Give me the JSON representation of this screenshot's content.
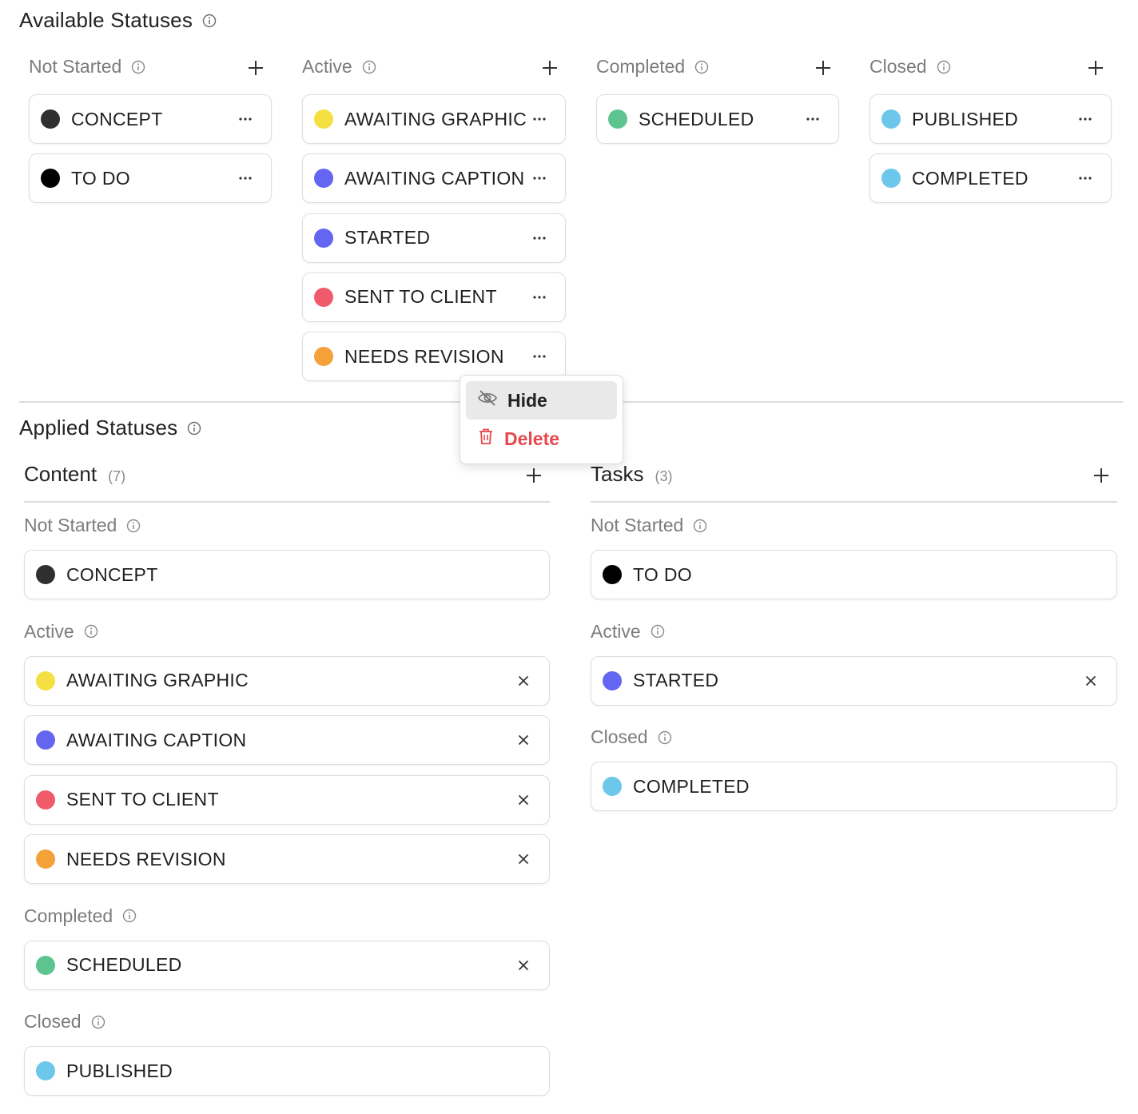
{
  "available": {
    "title": "Available Statuses",
    "columns": [
      {
        "label": "Not Started",
        "items": [
          {
            "label": "CONCEPT",
            "color": "#2f2f2f"
          },
          {
            "label": "TO DO",
            "color": "#000000"
          }
        ]
      },
      {
        "label": "Active",
        "items": [
          {
            "label": "AWAITING GRAPHIC",
            "color": "#f5e042"
          },
          {
            "label": "AWAITING CAPTION",
            "color": "#6466f1"
          },
          {
            "label": "STARTED",
            "color": "#6466f1"
          },
          {
            "label": "SENT TO CLIENT",
            "color": "#ef5b6b"
          },
          {
            "label": "NEEDS REVISION",
            "color": "#f5a13a"
          }
        ]
      },
      {
        "label": "Completed",
        "items": [
          {
            "label": "SCHEDULED",
            "color": "#5ec48f"
          }
        ]
      },
      {
        "label": "Closed",
        "items": [
          {
            "label": "PUBLISHED",
            "color": "#6cc7ea"
          },
          {
            "label": "COMPLETED",
            "color": "#6cc7ea"
          }
        ]
      }
    ]
  },
  "context_menu": {
    "hide_label": "Hide",
    "delete_label": "Delete",
    "delete_color": "#e5484d"
  },
  "applied": {
    "title": "Applied Statuses",
    "groups": [
      {
        "name": "Content",
        "count": "(7)",
        "sections": [
          {
            "label": "Not Started",
            "items": [
              {
                "label": "CONCEPT",
                "color": "#2f2f2f",
                "removable": false
              }
            ]
          },
          {
            "label": "Active",
            "items": [
              {
                "label": "AWAITING GRAPHIC",
                "color": "#f5e042",
                "removable": true
              },
              {
                "label": "AWAITING CAPTION",
                "color": "#6466f1",
                "removable": true
              },
              {
                "label": "SENT TO CLIENT",
                "color": "#ef5b6b",
                "removable": true
              },
              {
                "label": "NEEDS REVISION",
                "color": "#f5a13a",
                "removable": true
              }
            ]
          },
          {
            "label": "Completed",
            "items": [
              {
                "label": "SCHEDULED",
                "color": "#5ec48f",
                "removable": true
              }
            ]
          },
          {
            "label": "Closed",
            "items": [
              {
                "label": "PUBLISHED",
                "color": "#6cc7ea",
                "removable": false
              }
            ]
          }
        ]
      },
      {
        "name": "Tasks",
        "count": "(3)",
        "sections": [
          {
            "label": "Not Started",
            "items": [
              {
                "label": "TO DO",
                "color": "#000000",
                "removable": false
              }
            ]
          },
          {
            "label": "Active",
            "items": [
              {
                "label": "STARTED",
                "color": "#6466f1",
                "removable": true
              }
            ]
          },
          {
            "label": "Closed",
            "items": [
              {
                "label": "COMPLETED",
                "color": "#6cc7ea",
                "removable": false
              }
            ]
          }
        ]
      }
    ]
  }
}
